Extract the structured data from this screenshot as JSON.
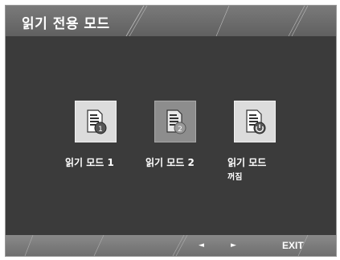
{
  "osd": {
    "title": "읽기 전용 모드"
  },
  "modes": [
    {
      "label": "읽기 모드 1",
      "icon": "document-reading-icon"
    },
    {
      "label": "읽기 모드 2",
      "icon": "document-reading-icon",
      "selected": true
    },
    {
      "label": "읽기 모드",
      "sublabel": "꺼짐",
      "icon": "document-power-off-icon"
    }
  ],
  "footer": {
    "left_label": "◄",
    "right_label": "►",
    "exit_label": "EXIT"
  },
  "colors": {
    "panel_bg": "#3b3b3b",
    "header_bg": "#6c6c6c",
    "footer_bg": "#7c7c7c",
    "tile_bg": "#dcdcdc",
    "tile_selected_bg": "#8d8d8d",
    "text": "#ffffff"
  }
}
